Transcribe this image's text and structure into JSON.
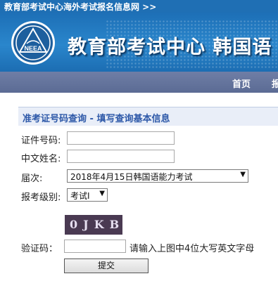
{
  "top_bar": {
    "text": "教育部考试中心海外考试报名信息网 >>"
  },
  "banner": {
    "title": "教育部考试中心  韩国语",
    "logo_text": "NEEA"
  },
  "nav": {
    "items": [
      {
        "label": "首页"
      },
      {
        "label": "报"
      }
    ]
  },
  "form": {
    "heading": "准考证号码查询 - 填写查询基本信息",
    "id_label": "证件号码:",
    "id_value": "",
    "name_label": "中文姓名:",
    "name_value": "",
    "session_label": "届次:",
    "session_value": "2018年4月15日韩国语能力考试",
    "level_label": "报考级别:",
    "level_value": "考试I",
    "captcha_image_text": "0JKB",
    "captcha_label": "验证码：",
    "captcha_value": "",
    "captcha_hint": "请输入上图中4位大写英文字母",
    "submit_label": "提交"
  },
  "colors": {
    "banner_blue": "#1f6fb4",
    "nav_bg": "#5b6b94",
    "heading_blue": "#2d58a8"
  },
  "icons": {
    "select_arrow": "▼"
  }
}
